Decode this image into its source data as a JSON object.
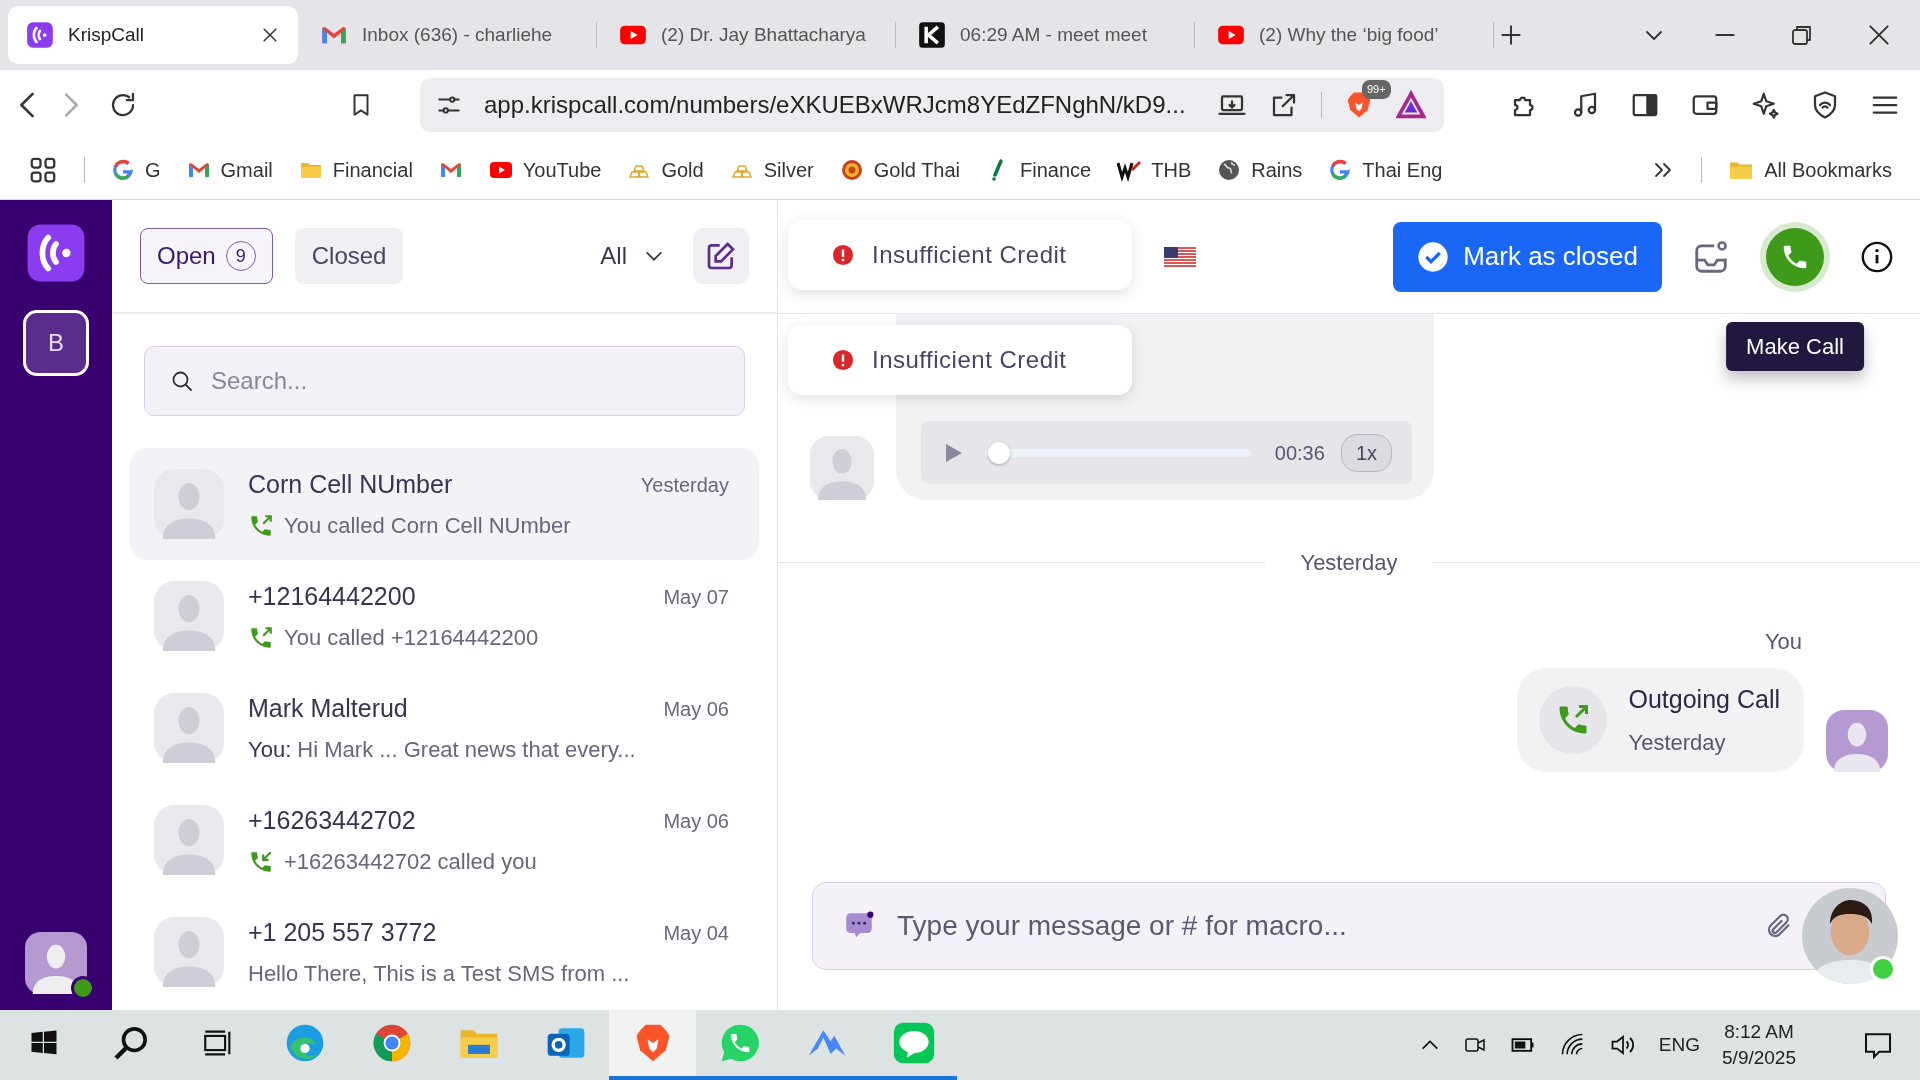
{
  "browser": {
    "tabs": [
      {
        "title": "KrispCall",
        "selected": true
      },
      {
        "title": "Inbox (636) - charliehe",
        "selected": false
      },
      {
        "title": "(2) Dr. Jay Bhattacharya",
        "selected": false
      },
      {
        "title": "06:29 AM - meet meet",
        "selected": false
      },
      {
        "title": "(2) Why the ‘big food’",
        "selected": false
      }
    ],
    "url": "app.krispcall.com/numbers/eXKUEBxWRJcm8YEdZFNghN/kD9...",
    "shield_badge": "99+",
    "bookmarks": [
      {
        "label": "G"
      },
      {
        "label": "Gmail"
      },
      {
        "label": "Financial"
      },
      {
        "label": "YouTube"
      },
      {
        "label": "Gold"
      },
      {
        "label": "Silver"
      },
      {
        "label": "Gold Thai"
      },
      {
        "label": "Finance"
      },
      {
        "label": "THB"
      },
      {
        "label": "Rains"
      },
      {
        "label": "Thai Eng"
      }
    ],
    "all_bookmarks": "All Bookmarks"
  },
  "sidebar": {
    "workspace": {
      "label": "B",
      "selected": true
    },
    "user_online": true
  },
  "inbox": {
    "filters": [
      {
        "label": "Open",
        "count": "9",
        "selected": true
      },
      {
        "label": "Closed",
        "selected": false
      }
    ],
    "dropdown": "All",
    "search": {
      "placeholder": "Search..."
    },
    "conversations": [
      {
        "name": "Corn Cell NUmber",
        "time": "Yesterday",
        "preview": "You called Corn Cell NUmber",
        "kind": "outgoing_call",
        "selected": true
      },
      {
        "name": "+12164442200",
        "time": "May 07",
        "preview": "You called +12164442200",
        "kind": "outgoing_call",
        "selected": false
      },
      {
        "name": "Mark Malterud",
        "time": "May 06",
        "preview": "**You:** Hi Mark ... Great news that every...",
        "kind": "message",
        "selected": false
      },
      {
        "name": "+16263442702",
        "time": "May 06",
        "preview": "+16263442702 called you",
        "kind": "incoming_call",
        "selected": false
      },
      {
        "name": "+1 205 557 3772",
        "time": "May 04",
        "preview": "Hello There, This is a Test SMS from ...",
        "kind": "message",
        "selected": false
      }
    ]
  },
  "chat": {
    "toasts": [
      "Insufficient Credit",
      "Insufficient Credit"
    ],
    "mark_closed": "Mark as closed",
    "tooltip": "Make Call",
    "audio": {
      "time": "00:36",
      "speed": "1x",
      "level": 0.02
    },
    "date_divider": "Yesterday",
    "sender": "You",
    "call": {
      "title": "Outgoing Call",
      "time": "Yesterday"
    },
    "composer": {
      "placeholder": "Type your message or # for macro..."
    },
    "agent_online": true
  },
  "taskbar": {
    "apps": [
      {
        "kind": "edge",
        "running": false,
        "selected": false
      },
      {
        "kind": "chrome",
        "running": false,
        "selected": false
      },
      {
        "kind": "files",
        "running": false,
        "selected": false
      },
      {
        "kind": "outlook",
        "running": false,
        "selected": false
      },
      {
        "kind": "brave",
        "running": true,
        "selected": true
      },
      {
        "kind": "whatsapp",
        "running": true,
        "selected": false
      },
      {
        "kind": "nord",
        "running": true,
        "selected": false
      },
      {
        "kind": "line",
        "running": true,
        "selected": false
      }
    ],
    "language": "ENG",
    "time": "8:12 AM",
    "date": "5/9/2025"
  }
}
